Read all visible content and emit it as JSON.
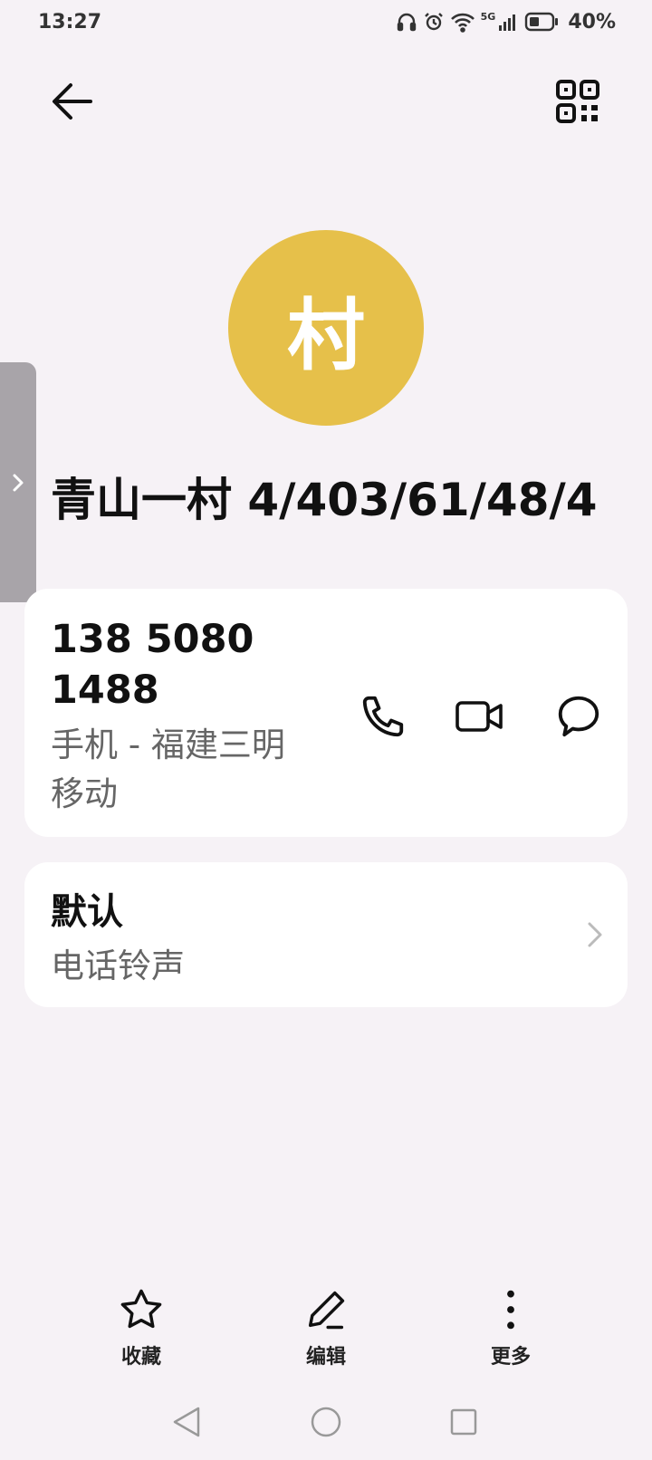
{
  "status_bar": {
    "time": "13:27",
    "battery": "40%",
    "network": "5G"
  },
  "contact": {
    "avatar_initial": "村",
    "name": "青山一村 4/403/61/48/4",
    "avatar_color": "#e6c04a"
  },
  "phone_card": {
    "number_line1": "138 5080",
    "number_line2": "1488",
    "location_line1": "手机 - 福建三明",
    "location_line2": "移动"
  },
  "ringtone_card": {
    "value": "默认",
    "label": "电话铃声"
  },
  "bottom_bar": {
    "favorite_label": "收藏",
    "edit_label": "编辑",
    "more_label": "更多"
  },
  "icons": {
    "back": "arrow-left-icon",
    "qr": "qr-code-icon",
    "call": "phone-icon",
    "video": "video-camera-icon",
    "message": "chat-bubble-icon",
    "favorite": "star-icon",
    "edit": "pencil-icon",
    "more": "more-vertical-icon"
  }
}
